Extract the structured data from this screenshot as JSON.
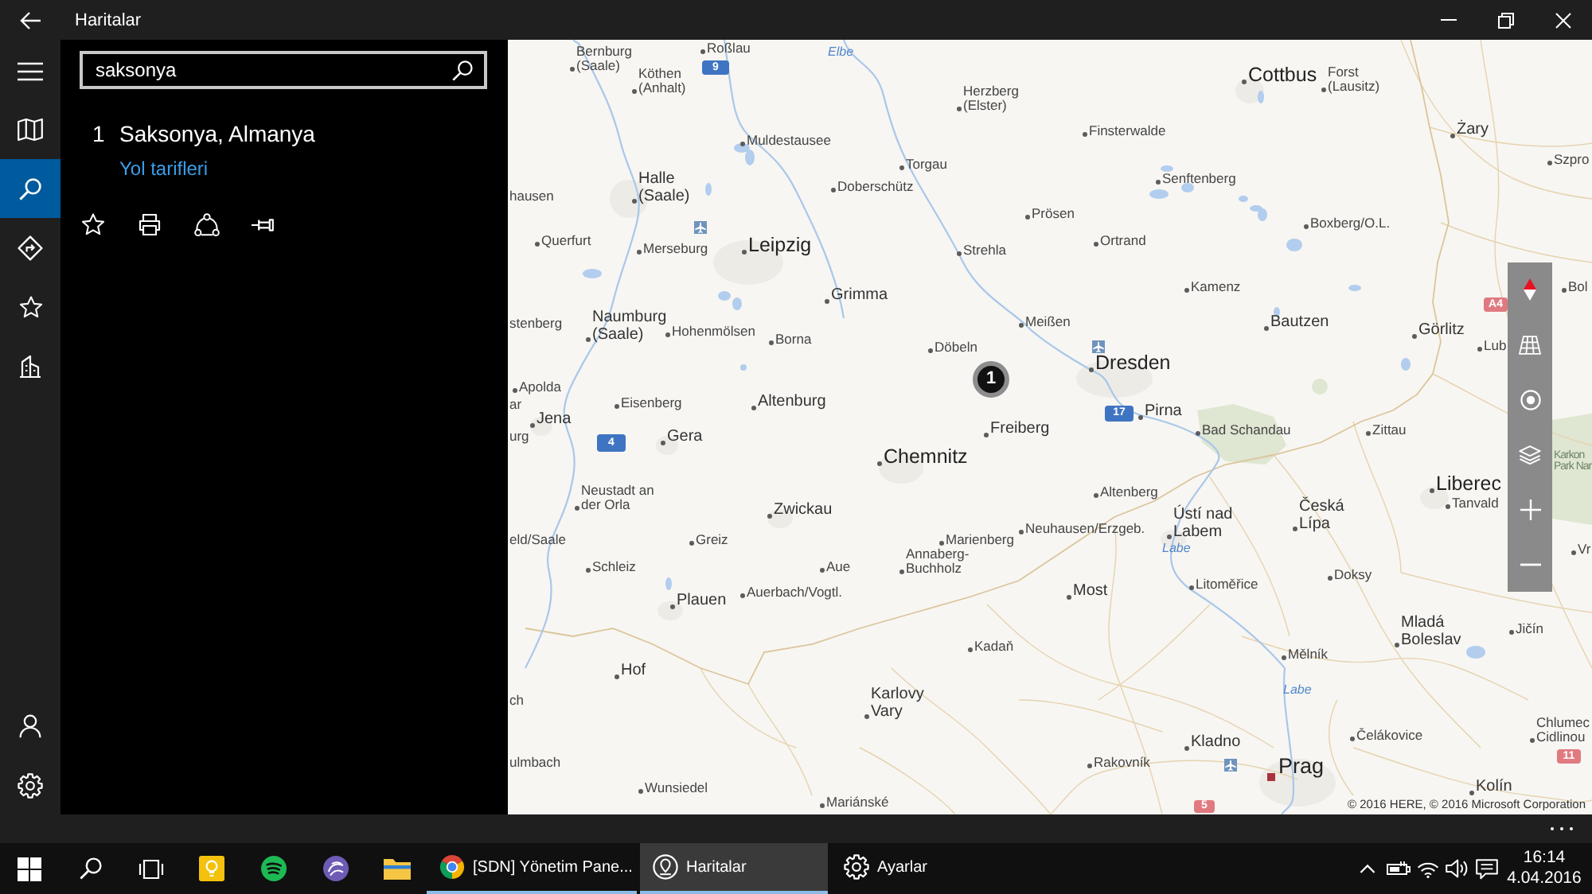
{
  "window": {
    "title": "Haritalar"
  },
  "nav": {
    "items": [
      {
        "kind": "menu",
        "selected": false
      },
      {
        "kind": "map",
        "selected": false
      },
      {
        "kind": "search",
        "selected": true
      },
      {
        "kind": "directions",
        "selected": false
      },
      {
        "kind": "favorites",
        "selected": false
      },
      {
        "kind": "cities",
        "selected": false
      }
    ],
    "bottom": [
      {
        "kind": "account"
      },
      {
        "kind": "settings"
      }
    ]
  },
  "search": {
    "value": "saksonya"
  },
  "results": [
    {
      "index": "1",
      "title": "Saksonya, Almanya",
      "link": "Yol tarifleri"
    }
  ],
  "result_actions": [
    {
      "kind": "favorite"
    },
    {
      "kind": "print"
    },
    {
      "kind": "share"
    },
    {
      "kind": "pin"
    }
  ],
  "map": {
    "places": [
      {
        "lines": [
          "Bernburg",
          "(Saale)"
        ],
        "kind": "village"
      },
      {
        "lines": [
          "Roßlau"
        ],
        "kind": "village"
      },
      {
        "lines": [
          "Elbe"
        ],
        "kind": "river"
      },
      {
        "lines": [
          "Köthen",
          "(Anhalt)"
        ],
        "kind": "village"
      },
      {
        "lines": [
          "Herzberg",
          "(Elster)"
        ],
        "kind": "village"
      },
      {
        "lines": [
          "Cottbus"
        ],
        "kind": "major"
      },
      {
        "lines": [
          "Forst",
          "(Lausitz)"
        ],
        "kind": "village"
      },
      {
        "lines": [
          "Muldestausee"
        ],
        "kind": "village"
      },
      {
        "lines": [
          "Finsterwalde"
        ],
        "kind": "village"
      },
      {
        "lines": [
          "Żary"
        ],
        "kind": "town"
      },
      {
        "lines": [
          "Torgau"
        ],
        "kind": "village"
      },
      {
        "lines": [
          "Szpro"
        ],
        "kind": "village"
      },
      {
        "lines": [
          "hausen"
        ],
        "kind": "edge"
      },
      {
        "lines": [
          "Halle",
          "(Saale)"
        ],
        "kind": "town"
      },
      {
        "lines": [
          "Doberschütz"
        ],
        "kind": "village"
      },
      {
        "lines": [
          "Senftenberg"
        ],
        "kind": "village"
      },
      {
        "lines": [
          "Prösen"
        ],
        "kind": "village"
      },
      {
        "lines": [
          "Boxberg/O.L."
        ],
        "kind": "village"
      },
      {
        "lines": [
          "Querfurt"
        ],
        "kind": "village"
      },
      {
        "lines": [
          "Merseburg"
        ],
        "kind": "village"
      },
      {
        "lines": [
          "Leipzig"
        ],
        "kind": "major"
      },
      {
        "lines": [
          "Strehla"
        ],
        "kind": "village"
      },
      {
        "lines": [
          "Ortrand"
        ],
        "kind": "village"
      },
      {
        "lines": [
          "Grimma"
        ],
        "kind": "town"
      },
      {
        "lines": [
          "Kamenz"
        ],
        "kind": "village"
      },
      {
        "lines": [
          "Bol"
        ],
        "kind": "village"
      },
      {
        "lines": [
          "stenberg"
        ],
        "kind": "edge"
      },
      {
        "lines": [
          "Naumburg",
          "(Saale)"
        ],
        "kind": "town"
      },
      {
        "lines": [
          "Hohenmölsen"
        ],
        "kind": "village"
      },
      {
        "lines": [
          "Meißen"
        ],
        "kind": "village"
      },
      {
        "lines": [
          "Bautzen"
        ],
        "kind": "town"
      },
      {
        "lines": [
          "Borna"
        ],
        "kind": "village"
      },
      {
        "lines": [
          "Görlitz"
        ],
        "kind": "town"
      },
      {
        "lines": [
          "Döbeln"
        ],
        "kind": "village"
      },
      {
        "lines": [
          "Lub"
        ],
        "kind": "village"
      },
      {
        "lines": [
          "Dresden"
        ],
        "kind": "major"
      },
      {
        "lines": [
          "Apolda"
        ],
        "kind": "village"
      },
      {
        "lines": [
          "ar"
        ],
        "kind": "edge"
      },
      {
        "lines": [
          "Eisenberg"
        ],
        "kind": "village"
      },
      {
        "lines": [
          "Altenburg"
        ],
        "kind": "town"
      },
      {
        "lines": [
          "Jena"
        ],
        "kind": "town"
      },
      {
        "lines": [
          "Pirna"
        ],
        "kind": "town"
      },
      {
        "lines": [
          "urg"
        ],
        "kind": "edge"
      },
      {
        "lines": [
          "Gera"
        ],
        "kind": "town"
      },
      {
        "lines": [
          "Freiberg"
        ],
        "kind": "town"
      },
      {
        "lines": [
          "Bad Schandau"
        ],
        "kind": "village"
      },
      {
        "lines": [
          "Zittau"
        ],
        "kind": "village"
      },
      {
        "lines": [
          "Chemnitz"
        ],
        "kind": "major"
      },
      {
        "lines": [
          "Karkon",
          "Park Nar"
        ],
        "kind": "park"
      },
      {
        "lines": [
          "Neustadt an",
          "der Orla"
        ],
        "kind": "village"
      },
      {
        "lines": [
          "Altenberg"
        ],
        "kind": "village"
      },
      {
        "lines": [
          "Liberec"
        ],
        "kind": "major"
      },
      {
        "lines": [
          "Zwickau"
        ],
        "kind": "town"
      },
      {
        "lines": [
          "eld/Saale"
        ],
        "kind": "edge"
      },
      {
        "lines": [
          "Greiz"
        ],
        "kind": "village"
      },
      {
        "lines": [
          "Marienberg"
        ],
        "kind": "village"
      },
      {
        "lines": [
          "Neuhausen/Erzgeb."
        ],
        "kind": "village"
      },
      {
        "lines": [
          "Ústí nad",
          "Labem"
        ],
        "kind": "town"
      },
      {
        "lines": [
          "Česká",
          "Lípa"
        ],
        "kind": "town"
      },
      {
        "lines": [
          "Tanvald"
        ],
        "kind": "village"
      },
      {
        "lines": [
          "Schleiz"
        ],
        "kind": "village"
      },
      {
        "lines": [
          "Aue"
        ],
        "kind": "village"
      },
      {
        "lines": [
          "Annaberg-",
          "Buchholz"
        ],
        "kind": "village"
      },
      {
        "lines": [
          "Labe"
        ],
        "kind": "river"
      },
      {
        "lines": [
          "Vr"
        ],
        "kind": "village"
      },
      {
        "lines": [
          "Plauen"
        ],
        "kind": "town"
      },
      {
        "lines": [
          "Auerbach/Vogtl."
        ],
        "kind": "village"
      },
      {
        "lines": [
          "Most"
        ],
        "kind": "town"
      },
      {
        "lines": [
          "Litoměřice"
        ],
        "kind": "village"
      },
      {
        "lines": [
          "Doksy"
        ],
        "kind": "village"
      },
      {
        "lines": [
          "Kadaň"
        ],
        "kind": "village"
      },
      {
        "lines": [
          "Mělník"
        ],
        "kind": "village"
      },
      {
        "lines": [
          "Mladá",
          "Boleslav"
        ],
        "kind": "town"
      },
      {
        "lines": [
          "Jičín"
        ],
        "kind": "village"
      },
      {
        "lines": [
          "Hof"
        ],
        "kind": "town"
      },
      {
        "lines": [
          "ch"
        ],
        "kind": "edge"
      },
      {
        "lines": [
          "Karlovy",
          "Vary"
        ],
        "kind": "town"
      },
      {
        "lines": [
          "Labe"
        ],
        "kind": "river"
      },
      {
        "lines": [
          "Kladno"
        ],
        "kind": "town"
      },
      {
        "lines": [
          "Čelákovice"
        ],
        "kind": "village"
      },
      {
        "lines": [
          "Chlumec",
          "Cidlinou"
        ],
        "kind": "village"
      },
      {
        "lines": [
          "ulmbach"
        ],
        "kind": "edge"
      },
      {
        "lines": [
          "Rakovník"
        ],
        "kind": "village"
      },
      {
        "lines": [
          "Prag"
        ],
        "kind": "capital"
      },
      {
        "lines": [
          "Wunsiedel"
        ],
        "kind": "village"
      },
      {
        "lines": [
          "Mariánské"
        ],
        "kind": "village"
      },
      {
        "lines": [
          "Kolín"
        ],
        "kind": "town"
      }
    ],
    "shields": [
      {
        "label": "9",
        "color": "#3f74c2"
      },
      {
        "label": "A4",
        "color": "#e07a80"
      },
      {
        "label": "17",
        "color": "#3f74c2"
      },
      {
        "label": "4",
        "color": "#3f74c2"
      },
      {
        "label": "11",
        "color": "#e07a80"
      },
      {
        "label": "5",
        "color": "#e07a80"
      }
    ],
    "marker": {
      "label": "1"
    },
    "controls": [
      {
        "kind": "compass"
      },
      {
        "kind": "tilt"
      },
      {
        "kind": "locate"
      },
      {
        "kind": "layers"
      },
      {
        "kind": "zoom_in"
      },
      {
        "kind": "zoom_out"
      }
    ],
    "copyright": "© 2016 HERE, © 2016 Microsoft Corporation"
  },
  "taskbar": {
    "pinned": [
      {
        "kind": "start"
      },
      {
        "kind": "search"
      },
      {
        "kind": "task_view"
      },
      {
        "kind": "tips"
      },
      {
        "kind": "music"
      },
      {
        "kind": "torrent"
      },
      {
        "kind": "files"
      }
    ],
    "windows": [
      {
        "kind": "browser",
        "label": "[SDN] Yönetim Pane...",
        "selected": false,
        "running": true
      },
      {
        "kind": "maps",
        "label": "Haritalar",
        "selected": true,
        "running": true
      },
      {
        "kind": "settings",
        "label": "Ayarlar",
        "selected": false,
        "running": false
      }
    ],
    "tray": [
      {
        "kind": "overflow"
      },
      {
        "kind": "battery"
      },
      {
        "kind": "network"
      },
      {
        "kind": "volume"
      },
      {
        "kind": "notifications"
      }
    ],
    "clock": {
      "time": "16:14",
      "date": "4.04.2016"
    }
  }
}
